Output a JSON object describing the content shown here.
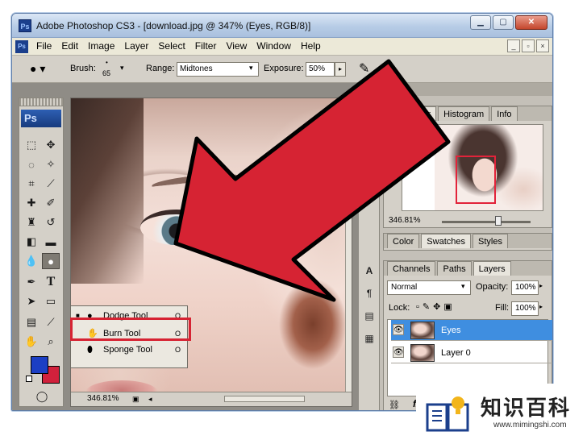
{
  "window": {
    "title": "Adobe Photoshop CS3 - [download.jpg @ 347% (Eyes, RGB/8)]",
    "app_icon": "Ps",
    "controls": {
      "minimize": "▁",
      "maximize": "▢",
      "close": "✕"
    },
    "doc_controls": [
      "_",
      "▫",
      "×"
    ]
  },
  "menu": [
    "File",
    "Edit",
    "Image",
    "Layer",
    "Select",
    "Filter",
    "View",
    "Window",
    "Help"
  ],
  "options": {
    "brush_label": "Brush:",
    "brush_size": "65",
    "range_label": "Range:",
    "range_value": "Midtones",
    "exposure_label": "Exposure:",
    "exposure_value": "50%"
  },
  "toolbox": {
    "logo": "Ps",
    "text_tool": "T"
  },
  "flyout": {
    "items": [
      {
        "label": "Dodge Tool",
        "key": "O",
        "selected": true
      },
      {
        "label": "Burn Tool",
        "key": "O",
        "selected": false
      },
      {
        "label": "Sponge Tool",
        "key": "O",
        "selected": false
      }
    ]
  },
  "document": {
    "zoom": "346.81%"
  },
  "navigator": {
    "tabs": [
      "Navigator",
      "Histogram",
      "Info"
    ],
    "zoom": "346.81%"
  },
  "color_panel": {
    "tabs": [
      "Color",
      "Swatches",
      "Styles"
    ]
  },
  "layers_panel": {
    "tabs": [
      "Channels",
      "Paths",
      "Layers"
    ],
    "blend_mode": "Normal",
    "opacity_label": "Opacity:",
    "opacity_value": "100%",
    "lock_label": "Lock:",
    "fill_label": "Fill:",
    "fill_value": "100%",
    "layers": [
      {
        "name": "Eyes",
        "selected": true
      },
      {
        "name": "Layer 0",
        "selected": false
      }
    ],
    "footer_fx": "fx"
  },
  "watermark": {
    "title": "知识百科",
    "url": "www.mimingshi.com"
  },
  "colors": {
    "arrow": "#d62333",
    "foreground": "#1c3fc4",
    "background": "#d1213c",
    "selection": "#3f8ee0"
  }
}
